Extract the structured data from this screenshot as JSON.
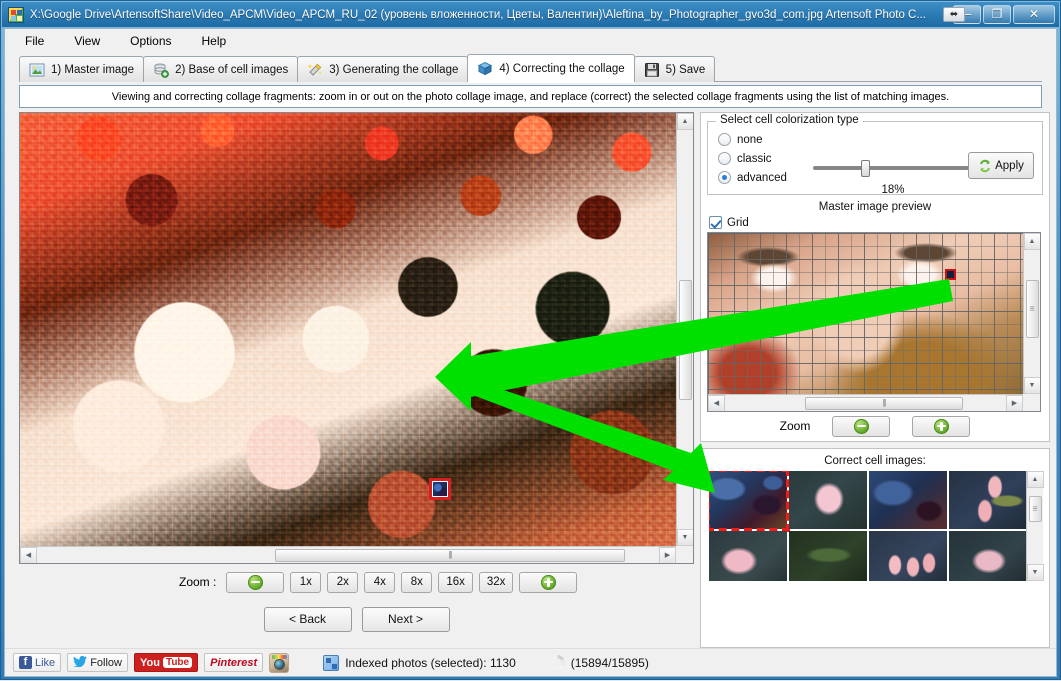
{
  "window": {
    "title": "X:\\Google Drive\\ArtensoftShare\\Video_APCM\\Video_APCM_RU_02 (уровень вложенности, Цветы, Валентин)\\Aleftina_by_Photographer_gvo3d_com.jpg Artensoft Photo C...",
    "app_icon": "artensoft-app-icon",
    "buttons": {
      "restore_small": "⬌",
      "minimize": "─",
      "maximize": "❐",
      "close": "✕"
    }
  },
  "menu": [
    {
      "label": "File",
      "accel": "F"
    },
    {
      "label": "View",
      "accel": "V"
    },
    {
      "label": "Options",
      "accel": "O"
    },
    {
      "label": "Help",
      "accel": "H"
    }
  ],
  "tabs": [
    {
      "label": "1) Master image",
      "icon": "picture-icon",
      "active": false
    },
    {
      "label": "2) Base of cell images",
      "icon": "database-add-icon",
      "active": false
    },
    {
      "label": "3) Generating the collage",
      "icon": "magic-wand-icon",
      "active": false
    },
    {
      "label": "4) Correcting the collage",
      "icon": "blue-box-icon",
      "active": true
    },
    {
      "label": "5) Save",
      "icon": "floppy-disk-icon",
      "active": false
    }
  ],
  "hint": "Viewing and correcting collage fragments: zoom in or out on the photo collage image, and replace (correct) the selected collage fragments using the list of matching images.",
  "colorization": {
    "group_title": "Select cell colorization type",
    "options": [
      {
        "label": "none",
        "selected": false
      },
      {
        "label": "classic",
        "selected": false
      },
      {
        "label": "advanced",
        "selected": true
      }
    ],
    "slider_value": "18%",
    "slider_percent": 18,
    "apply_label": "Apply",
    "apply_icon": "recycle-refresh-icon"
  },
  "preview": {
    "title": "Master image preview",
    "grid_label": "Grid",
    "grid_checked": true,
    "zoom_label": "Zoom",
    "zoom_out_icon": "zoom-out-circle-icon",
    "zoom_in_icon": "zoom-in-circle-icon",
    "scroll_left_icon": "triangle-left-icon",
    "scroll_right_icon": "triangle-right-icon",
    "scroll_up_icon": "triangle-up-icon",
    "scroll_down_icon": "triangle-down-icon"
  },
  "cells": {
    "title": "Correct cell images:",
    "items": [
      {
        "name": "cell-candidate-1",
        "style": "c-blue",
        "selected": true
      },
      {
        "name": "cell-candidate-2",
        "style": "c-pinkflower",
        "selected": false
      },
      {
        "name": "cell-candidate-3",
        "style": "c-blue2",
        "selected": false
      },
      {
        "name": "cell-candidate-4",
        "style": "c-tulip",
        "selected": false
      },
      {
        "name": "cell-candidate-5",
        "style": "c-pink2",
        "selected": false
      },
      {
        "name": "cell-candidate-6",
        "style": "c-green",
        "selected": false
      },
      {
        "name": "cell-candidate-7",
        "style": "c-tulip2",
        "selected": false
      },
      {
        "name": "cell-candidate-8",
        "style": "c-petal",
        "selected": false
      }
    ]
  },
  "zoombar": {
    "label": "Zoom  :",
    "zoom_out_icon": "zoom-out-circle-icon",
    "zoom_in_icon": "zoom-in-circle-icon",
    "levels": [
      "1x",
      "2x",
      "4x",
      "8x",
      "16x",
      "32x"
    ]
  },
  "nav": {
    "back": "< Back",
    "next": "Next >"
  },
  "status": {
    "social": [
      {
        "id": "facebook",
        "label": "Like",
        "glyph": "f"
      },
      {
        "id": "twitter",
        "label": "Follow",
        "glyph": "▼"
      },
      {
        "id": "youtube",
        "label": "You",
        "glyph": "Tube"
      },
      {
        "id": "pinterest",
        "label": "Pinterest",
        "glyph": ""
      },
      {
        "id": "instagram",
        "label": "",
        "glyph": ""
      }
    ],
    "indexed_label": "Indexed photos (selected): 1130",
    "counter": "(15894/15895)",
    "indexed_icon": "photos-index-icon",
    "busy_icon": "loading-spinner-icon"
  },
  "colors": {
    "title_bar": "#2b7bb5",
    "accent_green": "#00e000",
    "selection_red": "#d81f1f",
    "radio_blue": "#2d7dd2"
  }
}
